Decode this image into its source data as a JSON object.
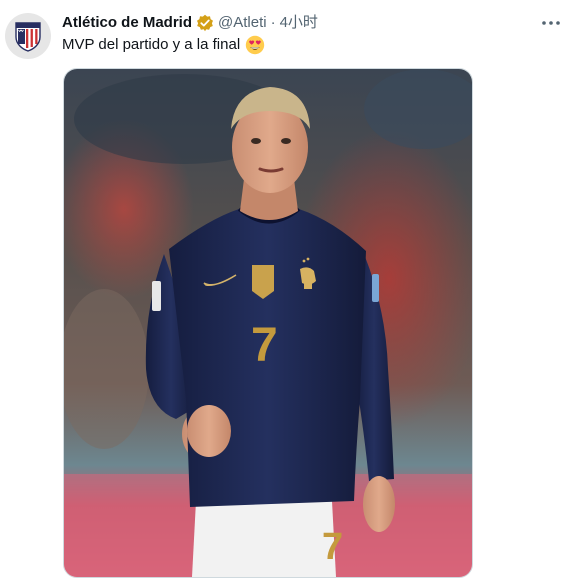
{
  "tweet": {
    "author_name": "Atlético de Madrid",
    "handle": "@Atleti",
    "separator": "·",
    "time": "4小时",
    "text": "MVP del partido y a la final",
    "emoji": "heart-eyes-emoji",
    "verified": true,
    "more_icon": "more-icon"
  },
  "media": {
    "jersey_number": "7",
    "shorts_number": "7"
  },
  "colors": {
    "verified_badge": "#d4a017",
    "jersey": "#1b2550",
    "secondary_text": "#536471",
    "crest_red": "#cb3234",
    "crest_blue": "#272e61"
  }
}
